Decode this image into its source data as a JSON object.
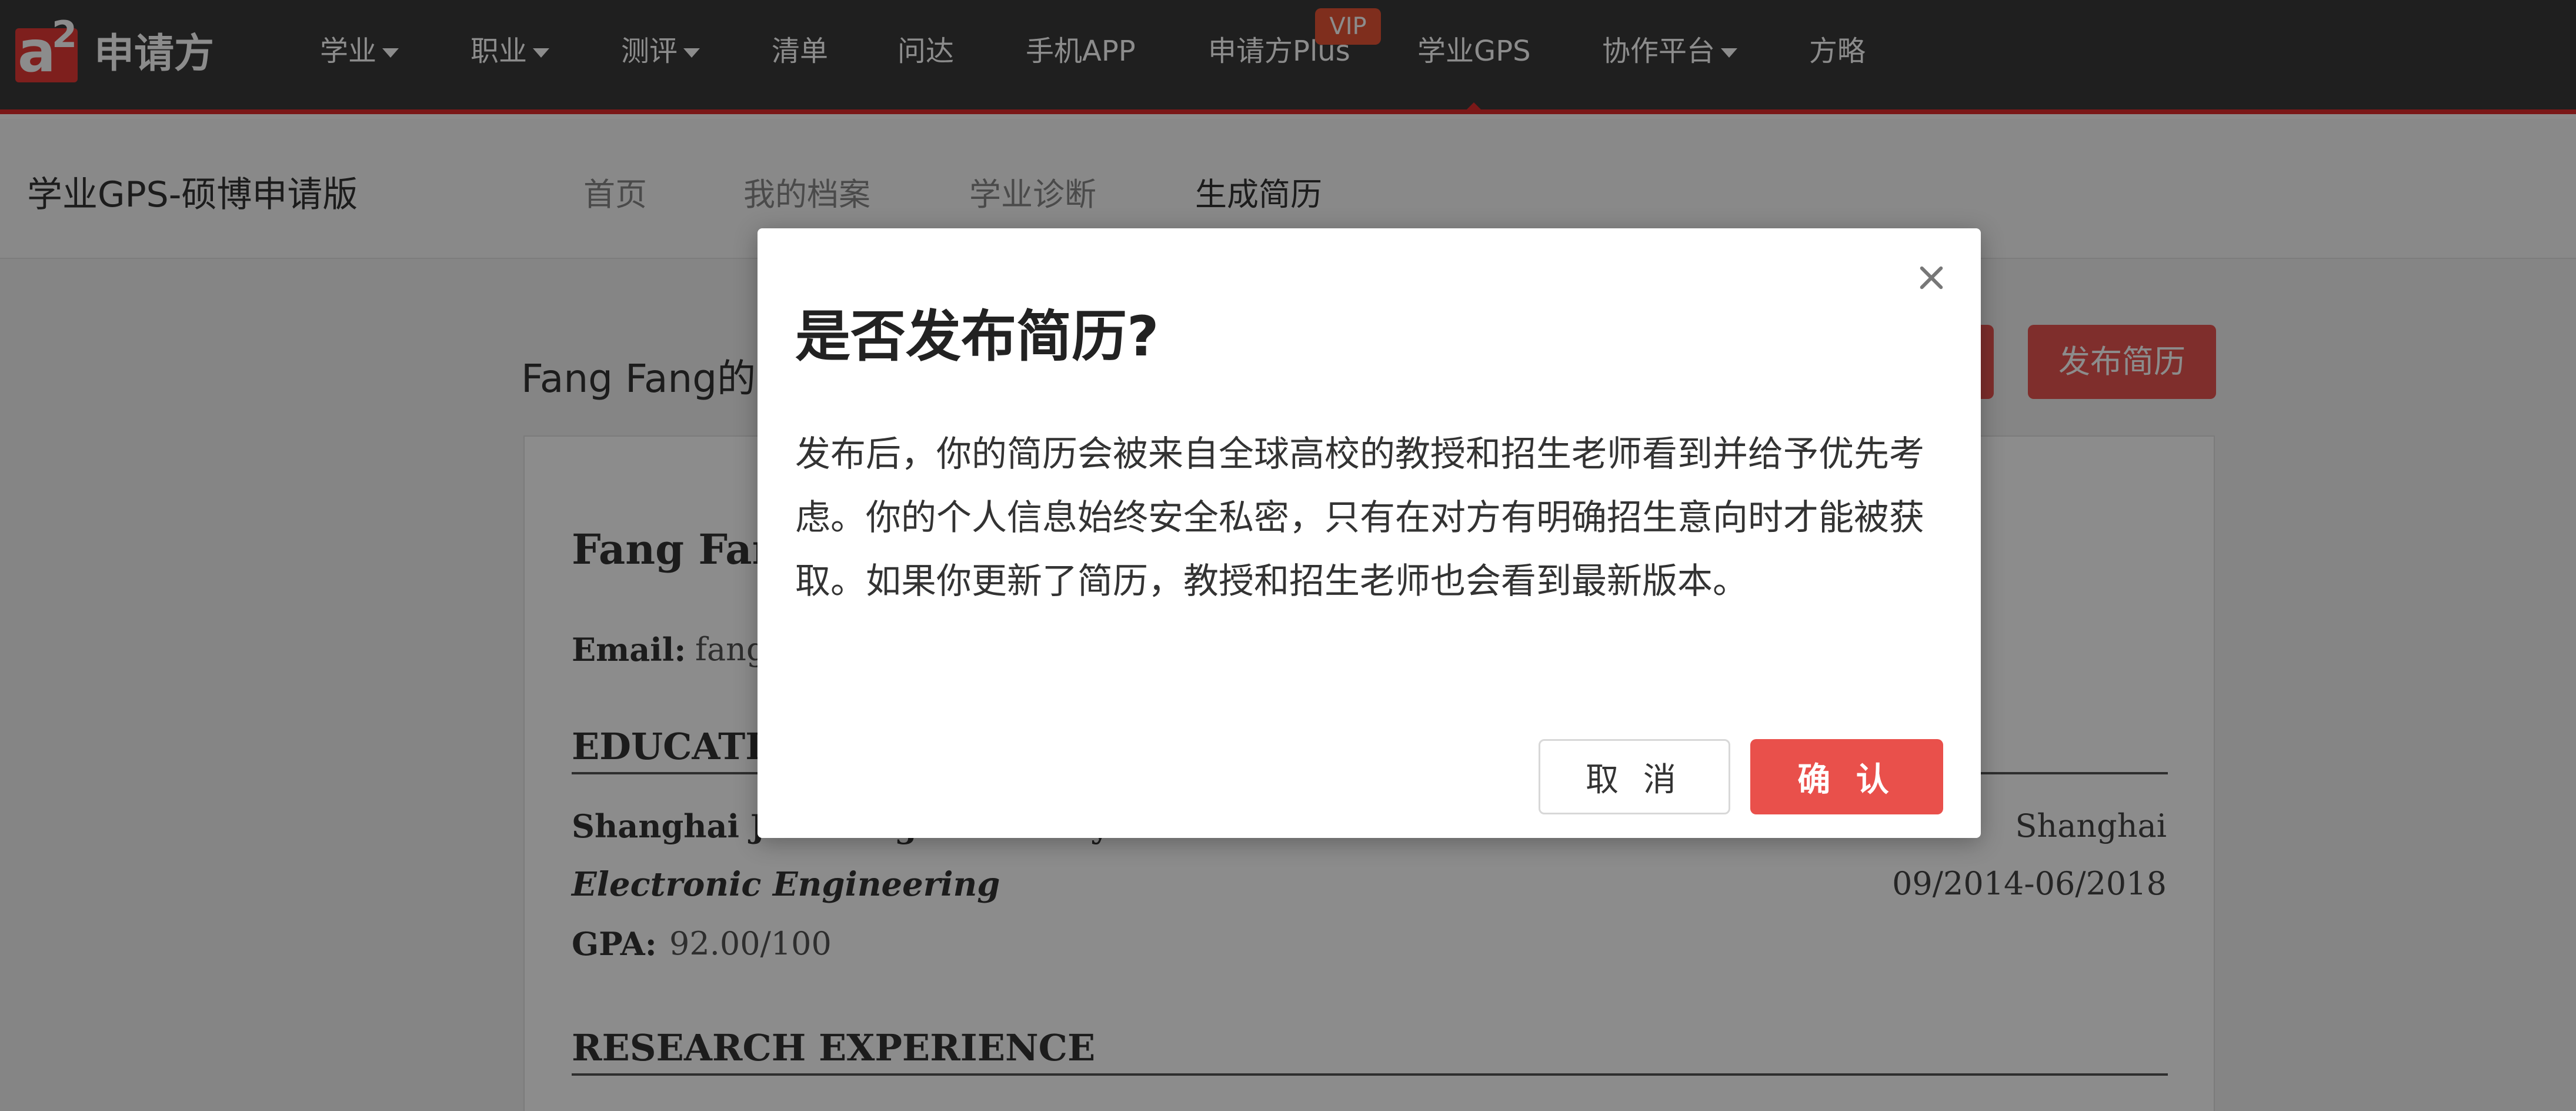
{
  "colors": {
    "nav_bg": "#3a3a3a",
    "accent": "#e02d2d",
    "button_red": "#e9504b",
    "overlay": "rgba(0,0,0,0.45)"
  },
  "topnav": {
    "logo_letter": "a",
    "logo_superscript": "2",
    "brand": "申请方",
    "items": [
      {
        "label": "学业",
        "dropdown": true
      },
      {
        "label": "职业",
        "dropdown": true
      },
      {
        "label": "测评",
        "dropdown": true
      },
      {
        "label": "清单",
        "dropdown": false
      },
      {
        "label": "问达",
        "dropdown": false
      },
      {
        "label": "手机APP",
        "dropdown": false
      },
      {
        "label": "申请方Plus",
        "dropdown": false,
        "badge": "VIP"
      },
      {
        "label": "学业GPS",
        "dropdown": false,
        "active": true
      },
      {
        "label": "协作平台",
        "dropdown": true
      },
      {
        "label": "方略",
        "dropdown": false
      }
    ]
  },
  "subnav": {
    "title": "学业GPS-硕博申请版",
    "items": [
      {
        "label": "首页"
      },
      {
        "label": "我的档案"
      },
      {
        "label": "学业诊断"
      },
      {
        "label": "生成简历",
        "active": true
      }
    ]
  },
  "page": {
    "heading": "Fang Fang的",
    "publish_button": "发布简历"
  },
  "resume": {
    "name": "Fang Fan",
    "email_label": "Email:",
    "email_value": "fang",
    "education_heading": "EDUCATI",
    "school": "Shanghai Jiao Tong University",
    "city": "Shanghai",
    "major": "Electronic Engineering",
    "dates": "09/2014-06/2018",
    "gpa_label": "GPA:",
    "gpa_value": "92.00/100",
    "research_heading": "RESEARCH EXPERIENCE"
  },
  "modal": {
    "title": "是否发布简历?",
    "body": "发布后，你的简历会被来自全球高校的教授和招生老师看到并给予优先考虑。你的个人信息始终安全私密，只有在对方有明确招生意向时才能被获取。如果你更新了简历，教授和招生老师也会看到最新版本。",
    "cancel_label": "取 消",
    "confirm_label": "确 认"
  }
}
